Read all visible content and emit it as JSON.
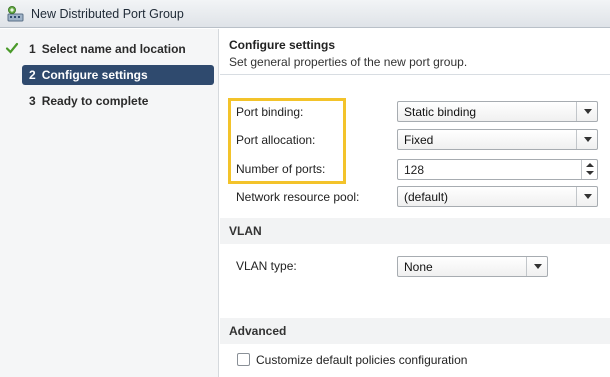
{
  "window": {
    "title": "New Distributed Port Group"
  },
  "steps": [
    {
      "num": "1",
      "label": "Select name and location",
      "done": true
    },
    {
      "num": "2",
      "label": "Configure settings",
      "active": true
    },
    {
      "num": "3",
      "label": "Ready to complete"
    }
  ],
  "header": {
    "title": "Configure settings",
    "subtitle": "Set general properties of the new port group."
  },
  "form": {
    "port_binding": {
      "label": "Port binding:",
      "value": "Static binding"
    },
    "port_allocation": {
      "label": "Port allocation:",
      "value": "Fixed"
    },
    "number_of_ports": {
      "label": "Number of ports:",
      "value": "128"
    },
    "network_resource_pool": {
      "label": "Network resource pool:",
      "value": "(default)"
    }
  },
  "vlan": {
    "section_title": "VLAN",
    "type_label": "VLAN type:",
    "type_value": "None"
  },
  "advanced": {
    "section_title": "Advanced",
    "customize_label": "Customize default policies configuration",
    "customize_checked": false
  },
  "colors": {
    "active_step_bg": "#2f4a6e",
    "highlight": "#f3c32a",
    "check": "#4a9a2a"
  }
}
